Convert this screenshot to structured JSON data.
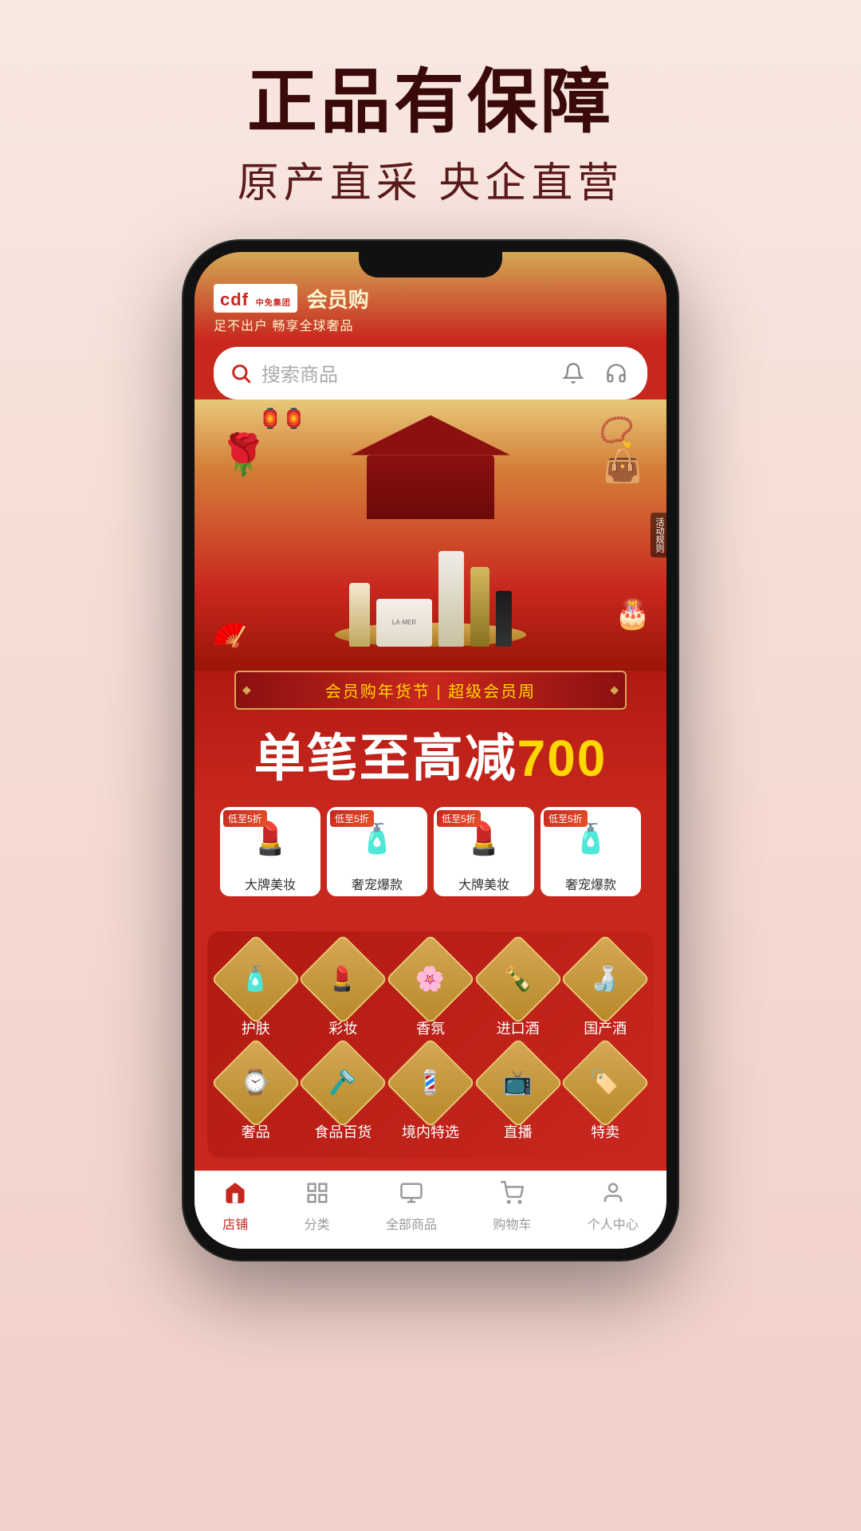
{
  "page": {
    "background_top_color": "#f8e8e0",
    "background_bottom_color": "#f0d0c8"
  },
  "hero_text": {
    "main_title": "正品有保障",
    "sub_title": "原产直采 央企直营"
  },
  "app": {
    "logo": "cdf",
    "logo_company": "中免集团",
    "logo_name": "会员购",
    "logo_tagline": "足不出户 畅享全球奢品",
    "search_placeholder": "搜索商品",
    "banner_promo_line": "会员购年货节 | 超级会员周",
    "banner_discount": "单笔至高减700",
    "discount_number": "700",
    "side_tag": "活动规则",
    "category_small": [
      {
        "label": "大牌美妆",
        "badge": "低至5折",
        "icon": "💄"
      },
      {
        "label": "奢宠爆款",
        "badge": "低至5折",
        "icon": "🧴"
      },
      {
        "label": "大牌美妆",
        "badge": "低至5折",
        "icon": "💄"
      },
      {
        "label": "奢宠爆款",
        "badge": "低至5折",
        "icon": "🧴"
      }
    ],
    "category_grid": [
      {
        "label": "护肤",
        "icon": "🧴"
      },
      {
        "label": "彩妆",
        "icon": "💄"
      },
      {
        "label": "香氛",
        "icon": "🌸"
      },
      {
        "label": "进口酒",
        "icon": "🍾"
      },
      {
        "label": "国产酒",
        "icon": "🍶"
      },
      {
        "label": "奢品",
        "icon": "⌚"
      },
      {
        "label": "食品百货",
        "icon": "🪒"
      },
      {
        "label": "境内特选",
        "icon": "💈"
      },
      {
        "label": "直播",
        "icon": "📦"
      },
      {
        "label": "特卖",
        "icon": "📦"
      }
    ],
    "bottom_nav": [
      {
        "label": "店铺",
        "icon": "🏠",
        "active": true
      },
      {
        "label": "分类",
        "icon": "⊞",
        "active": false
      },
      {
        "label": "全部商品",
        "icon": "◫",
        "active": false
      },
      {
        "label": "购物车",
        "icon": "🛒",
        "active": false
      },
      {
        "label": "个人中心",
        "icon": "👤",
        "active": false
      }
    ]
  }
}
